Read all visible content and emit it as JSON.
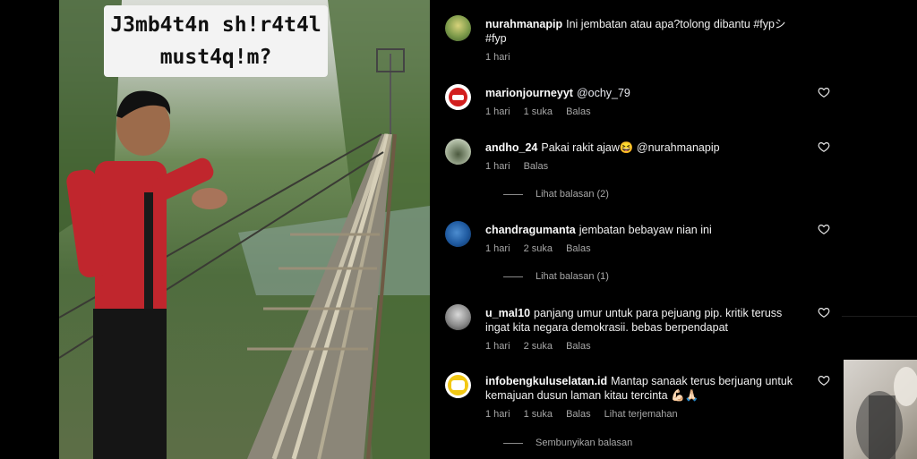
{
  "video": {
    "caption_line1": "J3mb4t4n sh!r4t4l",
    "caption_line2": "must4q!m?"
  },
  "comments": [
    {
      "user": "nurahmanapip",
      "text": "Ini jembatan atau apa?tolong dibantu #fypシ #fyp",
      "time": "1 hari",
      "likes": "",
      "reply": "",
      "translate": "",
      "replies_label": ""
    },
    {
      "user": "marionjourneyyt",
      "text": "@ochy_79",
      "time": "1 hari",
      "likes": "1 suka",
      "reply": "Balas",
      "translate": "",
      "replies_label": ""
    },
    {
      "user": "andho_24",
      "text": "Pakai rakit ajaw😆  @nurahmanapip",
      "time": "1 hari",
      "likes": "",
      "reply": "Balas",
      "translate": "",
      "replies_label": "Lihat balasan (2)"
    },
    {
      "user": "chandragumanta",
      "text": "jembatan bebayaw nian ini",
      "time": "1 hari",
      "likes": "2 suka",
      "reply": "Balas",
      "translate": "",
      "replies_label": "Lihat balasan (1)"
    },
    {
      "user": "u_mal10",
      "text": "panjang umur untuk para pejuang pip. kritik teruss ingat kita negara demokrasii. bebas berpendapat",
      "time": "1 hari",
      "likes": "2 suka",
      "reply": "Balas",
      "translate": "",
      "replies_label": ""
    },
    {
      "user": "infobengkuluselatan.id",
      "text": "Mantap sanaak terus berjuang untuk kemajuan dusun laman kitau tercinta 💪🏻🙏🏻",
      "time": "1 hari",
      "likes": "1 suka",
      "reply": "Balas",
      "translate": "Lihat terjemahan",
      "replies_label": "Sembunyikan balasan"
    }
  ],
  "icons": {
    "like": "heart-icon"
  },
  "colors": {
    "background": "#000000",
    "meta_text": "#a8a8a8",
    "shirt": "#c0262d"
  }
}
